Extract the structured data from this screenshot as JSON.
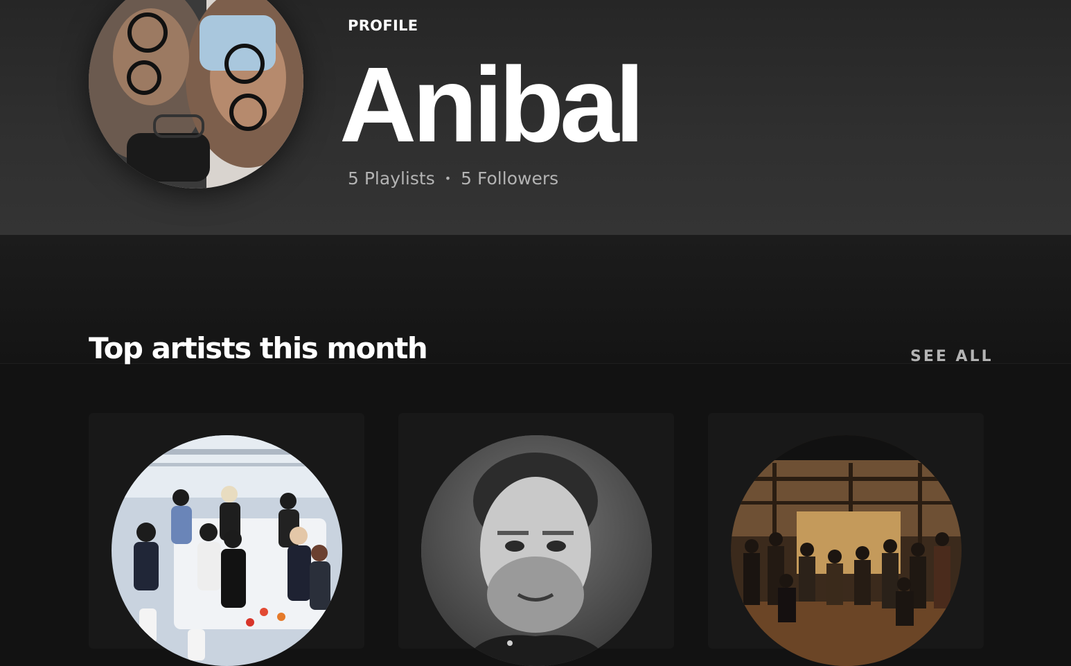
{
  "profile": {
    "label": "PROFILE",
    "name": "Anibal",
    "playlists": "5 Playlists",
    "separator": "•",
    "followers": "5 Followers"
  },
  "top_artists": {
    "title": "Top artists this month",
    "see_all": "SEE ALL",
    "artists": [
      {
        "image": "group-photo-laboratory"
      },
      {
        "image": "portrait-black-and-white"
      },
      {
        "image": "group-photo-warehouse"
      }
    ]
  },
  "colors": {
    "background": "#121212",
    "header": "#2f2f2f",
    "card": "#181818",
    "muted_text": "#b3b3b3"
  }
}
